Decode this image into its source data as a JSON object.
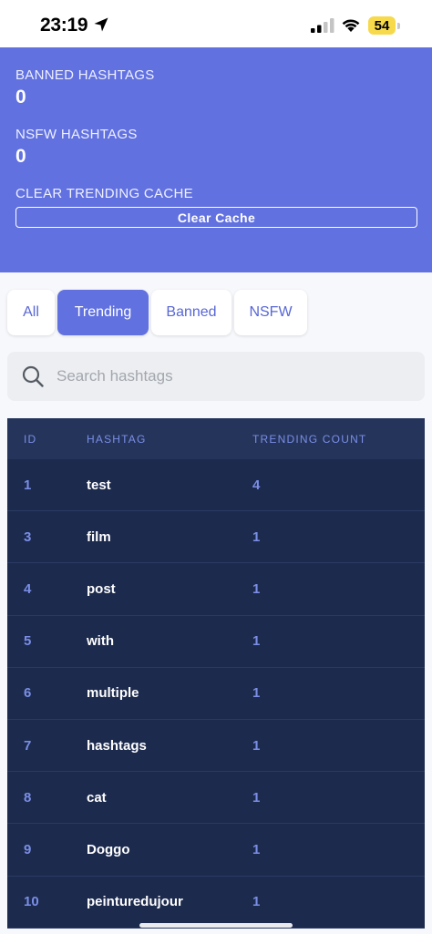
{
  "status_bar": {
    "time": "23:19",
    "battery": "54"
  },
  "stats": {
    "banned_label": "BANNED HASHTAGS",
    "banned_value": "0",
    "nsfw_label": "NSFW HASHTAGS",
    "nsfw_value": "0",
    "clear_label": "CLEAR TRENDING CACHE",
    "clear_button": "Clear Cache"
  },
  "tabs": [
    {
      "label": "All",
      "active": false
    },
    {
      "label": "Trending",
      "active": true
    },
    {
      "label": "Banned",
      "active": false
    },
    {
      "label": "NSFW",
      "active": false
    }
  ],
  "search": {
    "placeholder": "Search hashtags",
    "value": ""
  },
  "table": {
    "headers": [
      "ID",
      "HASHTAG",
      "TRENDING COUNT"
    ],
    "rows": [
      {
        "id": "1",
        "hashtag": "test",
        "count": "4"
      },
      {
        "id": "3",
        "hashtag": "film",
        "count": "1"
      },
      {
        "id": "4",
        "hashtag": "post",
        "count": "1"
      },
      {
        "id": "5",
        "hashtag": "with",
        "count": "1"
      },
      {
        "id": "6",
        "hashtag": "multiple",
        "count": "1"
      },
      {
        "id": "7",
        "hashtag": "hashtags",
        "count": "1"
      },
      {
        "id": "8",
        "hashtag": "cat",
        "count": "1"
      },
      {
        "id": "9",
        "hashtag": "Doggo",
        "count": "1"
      },
      {
        "id": "10",
        "hashtag": "peinturedujour",
        "count": "1"
      }
    ]
  },
  "colors": {
    "accent": "#6171e0",
    "table_bg": "#1c2a4d",
    "table_header_bg": "#25345b",
    "table_accent_text": "#7a8ee6"
  },
  "icons": {
    "location": "location-arrow-icon",
    "signal": "cellular-signal-icon",
    "wifi": "wifi-icon",
    "search": "search-icon"
  }
}
